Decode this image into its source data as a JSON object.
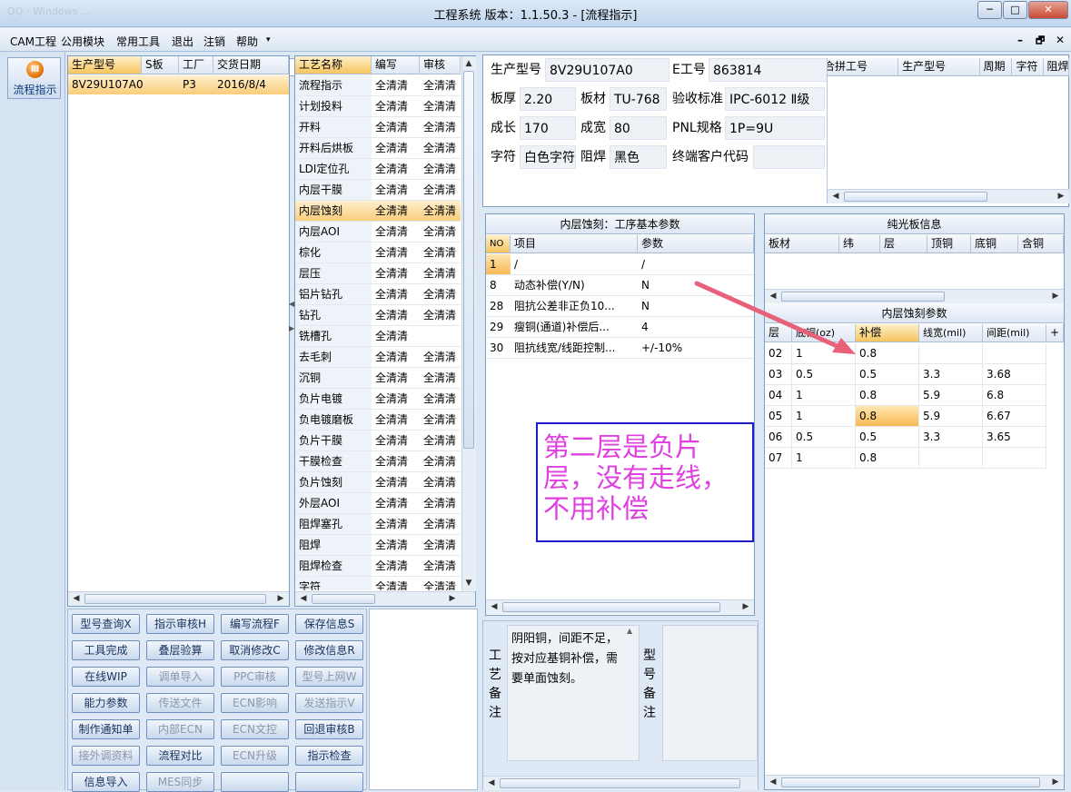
{
  "window": {
    "title": "工程系统   版本：1.1.50.3 - [流程指示]",
    "faded_text": "QQ - Windows ...",
    "buttons": {
      "minimize": "─",
      "maximize": "□",
      "close": "✕"
    }
  },
  "menu": {
    "items": [
      "CAM工程",
      "公用模块",
      "常用工具",
      "退出",
      "注销",
      "帮助"
    ],
    "more_arrow": "▾",
    "combo_value": "",
    "mdi_controls": [
      "–",
      "🗗",
      "✕"
    ]
  },
  "leftbar": {
    "button_label": "流程指示",
    "icon_glyph": "Ⅲ"
  },
  "order_list": {
    "headers": [
      "生产型号",
      "S板",
      "工厂",
      "交货日期"
    ],
    "rows": [
      {
        "model": "8V29U107A0",
        "s": "",
        "factory": "P3",
        "date": "2016/8/4"
      }
    ]
  },
  "process_list": {
    "headers": [
      "工艺名称",
      "编写",
      "审核"
    ],
    "rows": [
      [
        "流程指示",
        "全清清",
        "全清清"
      ],
      [
        "计划投料",
        "全清清",
        "全清清"
      ],
      [
        "开料",
        "全清清",
        "全清清"
      ],
      [
        "开料后烘板",
        "全清清",
        "全清清"
      ],
      [
        "LDI定位孔",
        "全清清",
        "全清清"
      ],
      [
        "内层干膜",
        "全清清",
        "全清清"
      ],
      [
        "内层蚀刻",
        "全清清",
        "全清清"
      ],
      [
        "内层AOI",
        "全清清",
        "全清清"
      ],
      [
        "棕化",
        "全清清",
        "全清清"
      ],
      [
        "层压",
        "全清清",
        "全清清"
      ],
      [
        "铝片钻孔",
        "全清清",
        "全清清"
      ],
      [
        "钻孔",
        "全清清",
        "全清清"
      ],
      [
        "铣槽孔",
        "全清清",
        ""
      ],
      [
        "去毛刺",
        "全清清",
        "全清清"
      ],
      [
        "沉铜",
        "全清清",
        "全清清"
      ],
      [
        "负片电镀",
        "全清清",
        "全清清"
      ],
      [
        "负电镀磨板",
        "全清清",
        "全清清"
      ],
      [
        "负片干膜",
        "全清清",
        "全清清"
      ],
      [
        "干膜检查",
        "全清清",
        "全清清"
      ],
      [
        "负片蚀刻",
        "全清清",
        "全清清"
      ],
      [
        "外层AOI",
        "全清清",
        "全清清"
      ],
      [
        "阻焊塞孔",
        "全清清",
        "全清清"
      ],
      [
        "阻焊",
        "全清清",
        "全清清"
      ],
      [
        "阻焊检查",
        "全清清",
        "全清清"
      ],
      [
        "字符",
        "全清清",
        "全清清"
      ]
    ],
    "selected_index": 6
  },
  "buttons": [
    {
      "label": "型号查询X",
      "enabled": true
    },
    {
      "label": "指示审核H",
      "enabled": true
    },
    {
      "label": "编写流程F",
      "enabled": true
    },
    {
      "label": "保存信息S",
      "enabled": true
    },
    {
      "label": "工具完成",
      "enabled": true
    },
    {
      "label": "叠层验算",
      "enabled": true
    },
    {
      "label": "取消修改C",
      "enabled": true
    },
    {
      "label": "修改信息R",
      "enabled": true
    },
    {
      "label": "在线WIP",
      "enabled": true
    },
    {
      "label": "调单导入",
      "enabled": false
    },
    {
      "label": "PPC审核",
      "enabled": false
    },
    {
      "label": "型号上网W",
      "enabled": false
    },
    {
      "label": "能力参数",
      "enabled": true
    },
    {
      "label": "传送文件",
      "enabled": false
    },
    {
      "label": "ECN影响",
      "enabled": false
    },
    {
      "label": "发送指示V",
      "enabled": false
    },
    {
      "label": "制作通知单",
      "enabled": true
    },
    {
      "label": "内部ECN",
      "enabled": false
    },
    {
      "label": "ECN文控",
      "enabled": false
    },
    {
      "label": "回退审核B",
      "enabled": true
    },
    {
      "label": "接外调资料",
      "enabled": false
    },
    {
      "label": "流程对比",
      "enabled": true
    },
    {
      "label": "ECN升级",
      "enabled": false
    },
    {
      "label": "指示检查",
      "enabled": true
    },
    {
      "label": "信息导入",
      "enabled": true
    },
    {
      "label": "MES同步",
      "enabled": false
    },
    {
      "label": "",
      "enabled": true
    },
    {
      "label": "",
      "enabled": true
    }
  ],
  "info": {
    "model_label": "生产型号",
    "model_value": "8V29U107A0",
    "eng_label": "E工号",
    "eng_value": "863814",
    "thickness_label": "板厚",
    "thickness_value": "2.20",
    "material_label": "板材",
    "material_value": "TU-768",
    "accept_label": "验收标准",
    "accept_value": "IPC-6012 Ⅱ级",
    "length_label": "成长",
    "length_value": "170",
    "width_label": "成宽",
    "width_value": "80",
    "pnl_label": "PNL规格",
    "pnl_value": "1P=9U",
    "silk_label": "字符",
    "silk_value": "白色字符",
    "mask_label": "阻焊",
    "mask_value": "黑色",
    "customer_label": "终端客户代码",
    "customer_value": ""
  },
  "merge_table": {
    "headers": [
      "合拼工号",
      "生产型号",
      "周期",
      "字符",
      "阻焊"
    ]
  },
  "base_params": {
    "title": "内层蚀刻：工序基本参数",
    "headers": [
      "NO",
      "项目",
      "参数"
    ],
    "rows": [
      [
        "1",
        "/",
        "/"
      ],
      [
        "8",
        "动态补偿(Y/N)",
        "N"
      ],
      [
        "28",
        "阻抗公差非正负10...",
        "N"
      ],
      [
        "29",
        "瘦铜(通道)补偿后...",
        "4"
      ],
      [
        "30",
        "阻抗线宽/线距控制...",
        "+/-10%"
      ]
    ]
  },
  "annotation": {
    "text": "第二层是负片层，没有走线，不用补偿"
  },
  "light_board": {
    "title": "纯光板信息",
    "headers": [
      "板材",
      "纬",
      "层",
      "顶铜",
      "底铜",
      "含铜"
    ]
  },
  "etch_params": {
    "title": "内层蚀刻参数",
    "headers": [
      "层",
      "底铜(oz)",
      "补偿",
      "线宽(mil)",
      "间距(mil)",
      "+"
    ],
    "rows": [
      [
        "02",
        "1",
        "0.8",
        "",
        ""
      ],
      [
        "03",
        "0.5",
        "0.5",
        "3.3",
        "3.68"
      ],
      [
        "04",
        "1",
        "0.8",
        "5.9",
        "6.8"
      ],
      [
        "05",
        "1",
        "0.8",
        "5.9",
        "6.67"
      ],
      [
        "06",
        "0.5",
        "0.5",
        "3.3",
        "3.65"
      ],
      [
        "07",
        "1",
        "0.8",
        "",
        ""
      ]
    ]
  },
  "remarks": {
    "process_label": "工艺备注",
    "process_text": "阴阳铜，间距不足，按对应基铜补偿，需要单面蚀刻。",
    "model_label": "型号备注",
    "model_text": ""
  },
  "colors": {
    "accent": "#f6b443",
    "annotation": "#e040e0",
    "arrow": "#e8607a",
    "border": "#1c1cc8"
  }
}
